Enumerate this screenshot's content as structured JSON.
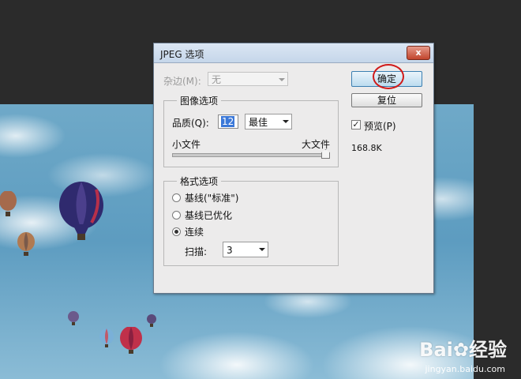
{
  "dialog": {
    "title": "JPEG 选项",
    "close_label": "x",
    "matte": {
      "label": "杂边(M):",
      "value": "无"
    },
    "image_options": {
      "group_title": "图像选项",
      "quality_label": "品质(Q):",
      "quality_value": "12",
      "quality_preset": "最佳",
      "small_file_label": "小文件",
      "large_file_label": "大文件",
      "slider_level_fraction": 1.0
    },
    "format_options": {
      "group_title": "格式选项",
      "options": [
        {
          "label": "基线(\"标准\")",
          "selected": false
        },
        {
          "label": "基线已优化",
          "selected": false
        },
        {
          "label": "连续",
          "selected": true
        }
      ],
      "scans_label": "扫描:",
      "scans_value": "3"
    },
    "ok_label": "确定",
    "reset_label": "复位",
    "preview_label": "预览(P)",
    "preview_checked": true,
    "file_size": "168.8K"
  },
  "watermark": {
    "brand": "Bai",
    "suffix": "经验",
    "url": "jingyan.baidu.com"
  },
  "colors": {
    "highlight_circle": "#d01a1a",
    "selection": "#3b78d8"
  }
}
